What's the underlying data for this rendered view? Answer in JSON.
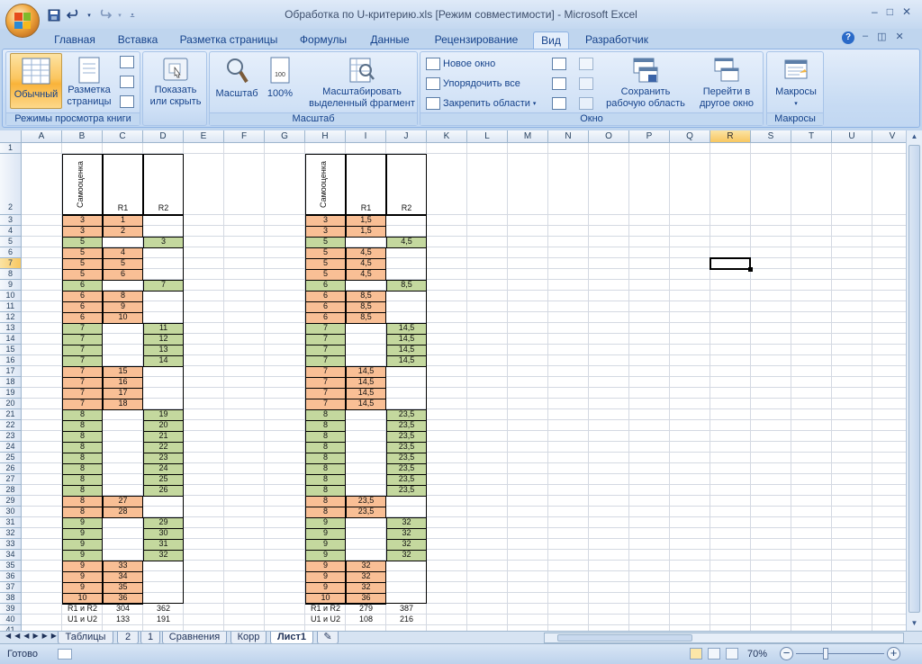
{
  "window": {
    "title": "Обработка по U-критерию.xls  [Режим совместимости] - Microsoft Excel",
    "controls": [
      "–",
      "□",
      "✕"
    ],
    "doc_controls": [
      "–",
      "◫",
      "✕"
    ]
  },
  "qat": {
    "icons": [
      "save-icon",
      "undo-icon",
      "redo-icon",
      "customize-icon"
    ]
  },
  "tabs": [
    {
      "label": "Главная"
    },
    {
      "label": "Вставка"
    },
    {
      "label": "Разметка страницы"
    },
    {
      "label": "Формулы"
    },
    {
      "label": "Данные"
    },
    {
      "label": "Рецензирование"
    },
    {
      "label": "Вид",
      "active": true
    },
    {
      "label": "Разработчик"
    }
  ],
  "ribbon": {
    "views": {
      "label": "Режимы просмотра книги",
      "normal": "Обычный",
      "page_layout_1": "Разметка",
      "page_layout_2": "страницы"
    },
    "show": {
      "label_1": "Показать",
      "label_2": "или скрыть"
    },
    "zoom": {
      "label": "Масштаб",
      "zoom_btn": "Масштаб",
      "hundred": "100%",
      "sel_1": "Масштабировать",
      "sel_2": "выделенный фрагмент"
    },
    "window": {
      "label": "Окно",
      "new_window": "Новое окно",
      "arrange_all": "Упорядочить все",
      "freeze": "Закрепить области",
      "save_ws_1": "Сохранить",
      "save_ws_2": "рабочую область",
      "switch_1": "Перейти в",
      "switch_2": "другое окно"
    },
    "macros": {
      "label": "Макросы",
      "btn": "Макросы"
    }
  },
  "columns": [
    "A",
    "B",
    "C",
    "D",
    "E",
    "F",
    "G",
    "H",
    "I",
    "J",
    "K",
    "L",
    "M",
    "N",
    "O",
    "P",
    "Q",
    "R",
    "S",
    "T",
    "U",
    "V"
  ],
  "selected_column": "R",
  "selected_row": 7,
  "left_table": {
    "h_col1": "Самооценка",
    "h_col2": "R1",
    "h_col3": "R2",
    "rows": [
      [
        "3",
        "1",
        "",
        "o"
      ],
      [
        "3",
        "2",
        "",
        "o"
      ],
      [
        "5",
        "",
        "3",
        "g"
      ],
      [
        "5",
        "4",
        "",
        "o"
      ],
      [
        "5",
        "5",
        "",
        "o"
      ],
      [
        "5",
        "6",
        "",
        "o"
      ],
      [
        "6",
        "",
        "7",
        "g"
      ],
      [
        "6",
        "8",
        "",
        "o"
      ],
      [
        "6",
        "9",
        "",
        "o"
      ],
      [
        "6",
        "10",
        "",
        "o"
      ],
      [
        "7",
        "",
        "11",
        "g"
      ],
      [
        "7",
        "",
        "12",
        "g"
      ],
      [
        "7",
        "",
        "13",
        "g"
      ],
      [
        "7",
        "",
        "14",
        "g"
      ],
      [
        "7",
        "15",
        "",
        "o"
      ],
      [
        "7",
        "16",
        "",
        "o"
      ],
      [
        "7",
        "17",
        "",
        "o"
      ],
      [
        "7",
        "18",
        "",
        "o"
      ],
      [
        "8",
        "",
        "19",
        "g"
      ],
      [
        "8",
        "",
        "20",
        "g"
      ],
      [
        "8",
        "",
        "21",
        "g"
      ],
      [
        "8",
        "",
        "22",
        "g"
      ],
      [
        "8",
        "",
        "23",
        "g"
      ],
      [
        "8",
        "",
        "24",
        "g"
      ],
      [
        "8",
        "",
        "25",
        "g"
      ],
      [
        "8",
        "",
        "26",
        "g"
      ],
      [
        "8",
        "27",
        "",
        "o"
      ],
      [
        "8",
        "28",
        "",
        "o"
      ],
      [
        "9",
        "",
        "29",
        "g"
      ],
      [
        "9",
        "",
        "30",
        "g"
      ],
      [
        "9",
        "",
        "31",
        "g"
      ],
      [
        "9",
        "",
        "32",
        "g"
      ],
      [
        "9",
        "33",
        "",
        "o"
      ],
      [
        "9",
        "34",
        "",
        "o"
      ],
      [
        "9",
        "35",
        "",
        "o"
      ],
      [
        "10",
        "36",
        "",
        "o"
      ]
    ],
    "sum_label": "R1 и R2",
    "sum_r1": "304",
    "sum_r2": "362",
    "u_label": "U1 и U2",
    "u1": "133",
    "u2": "191"
  },
  "right_table": {
    "h_col1": "Самооценка",
    "h_col2": "R1",
    "h_col3": "R2",
    "rows": [
      [
        "3",
        "1,5",
        "",
        "o"
      ],
      [
        "3",
        "1,5",
        "",
        "o"
      ],
      [
        "5",
        "",
        "4,5",
        "g"
      ],
      [
        "5",
        "4,5",
        "",
        "o"
      ],
      [
        "5",
        "4,5",
        "",
        "o"
      ],
      [
        "5",
        "4,5",
        "",
        "o"
      ],
      [
        "6",
        "",
        "8,5",
        "g"
      ],
      [
        "6",
        "8,5",
        "",
        "o"
      ],
      [
        "6",
        "8,5",
        "",
        "o"
      ],
      [
        "6",
        "8,5",
        "",
        "o"
      ],
      [
        "7",
        "",
        "14,5",
        "g"
      ],
      [
        "7",
        "",
        "14,5",
        "g"
      ],
      [
        "7",
        "",
        "14,5",
        "g"
      ],
      [
        "7",
        "",
        "14,5",
        "g"
      ],
      [
        "7",
        "14,5",
        "",
        "o"
      ],
      [
        "7",
        "14,5",
        "",
        "o"
      ],
      [
        "7",
        "14,5",
        "",
        "o"
      ],
      [
        "7",
        "14,5",
        "",
        "o"
      ],
      [
        "8",
        "",
        "23,5",
        "g"
      ],
      [
        "8",
        "",
        "23,5",
        "g"
      ],
      [
        "8",
        "",
        "23,5",
        "g"
      ],
      [
        "8",
        "",
        "23,5",
        "g"
      ],
      [
        "8",
        "",
        "23,5",
        "g"
      ],
      [
        "8",
        "",
        "23,5",
        "g"
      ],
      [
        "8",
        "",
        "23,5",
        "g"
      ],
      [
        "8",
        "",
        "23,5",
        "g"
      ],
      [
        "8",
        "23,5",
        "",
        "o"
      ],
      [
        "8",
        "23,5",
        "",
        "o"
      ],
      [
        "9",
        "",
        "32",
        "g"
      ],
      [
        "9",
        "",
        "32",
        "g"
      ],
      [
        "9",
        "",
        "32",
        "g"
      ],
      [
        "9",
        "",
        "32",
        "g"
      ],
      [
        "9",
        "32",
        "",
        "o"
      ],
      [
        "9",
        "32",
        "",
        "o"
      ],
      [
        "9",
        "32",
        "",
        "o"
      ],
      [
        "10",
        "36",
        "",
        "o"
      ]
    ],
    "sum_label": "R1 и R2",
    "sum_r1": "279",
    "sum_r2": "387",
    "u_label": "U1 и U2",
    "u1": "108",
    "u2": "216"
  },
  "sheets": [
    "Таблицы",
    "2",
    "1",
    "Сравнения",
    "Корр",
    "Лист1"
  ],
  "active_sheet": "Лист1",
  "status": {
    "ready": "Готово",
    "zoom": "70%"
  },
  "colors": {
    "orange": "#f9bf95",
    "green": "#c4d89e",
    "accent": "#15428b"
  }
}
